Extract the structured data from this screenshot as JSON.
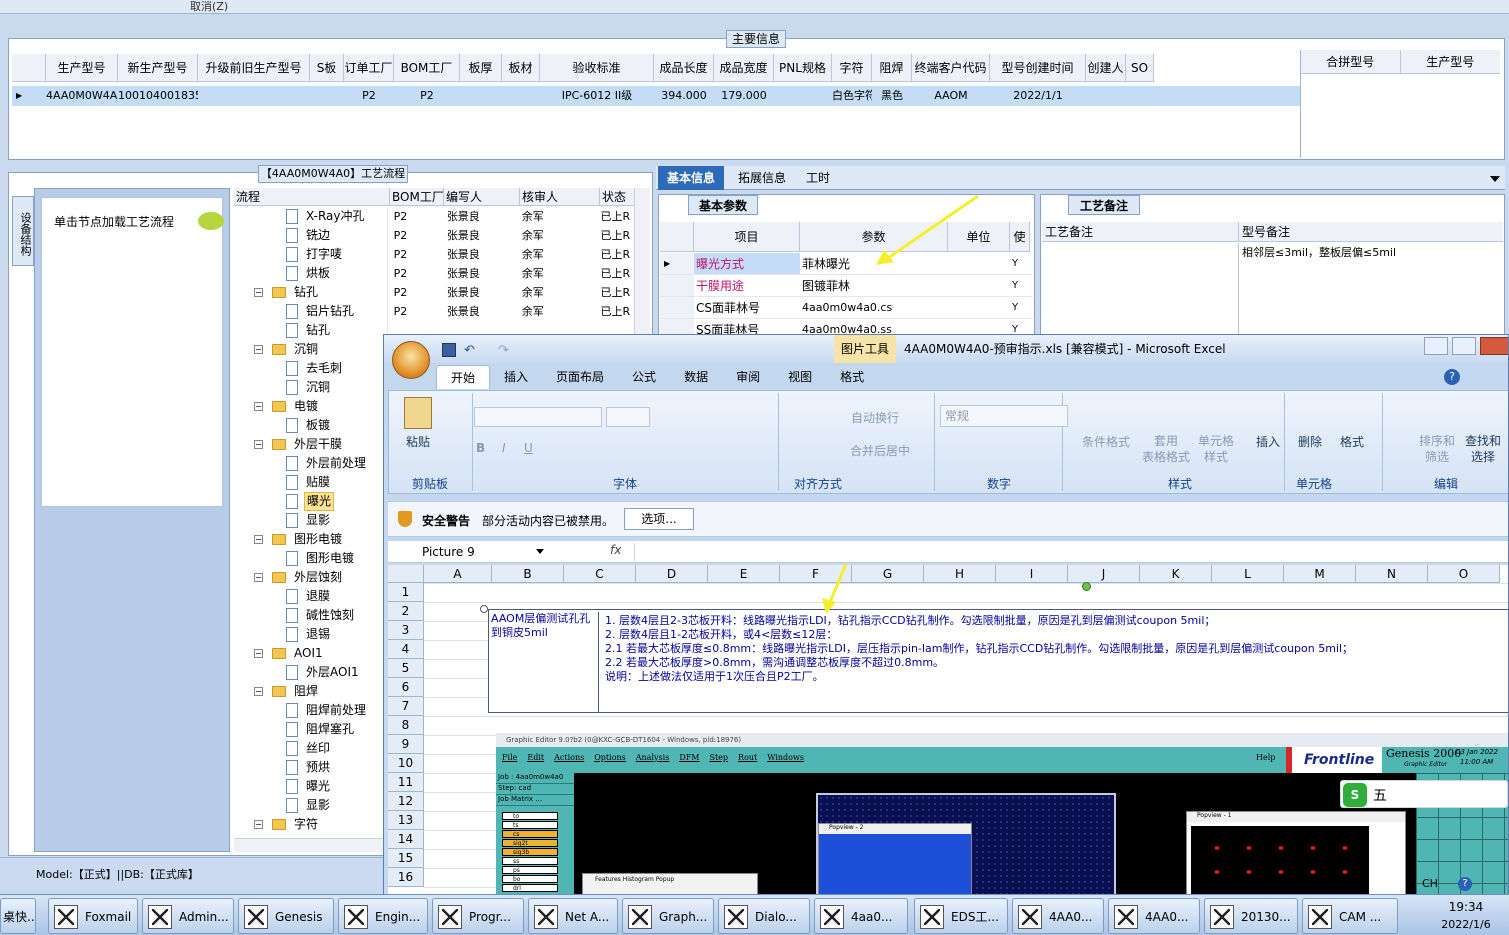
{
  "top_toolbar": {
    "cancel": "取消(Z)"
  },
  "main_info": {
    "title": "主要信息",
    "headers": [
      "生产型号",
      "新生产型号",
      "升级前旧生产型号",
      "S板",
      "订单工厂",
      "BOM工厂",
      "板厚",
      "板材",
      "验收标准",
      "成品长度",
      "成品宽度",
      "PNL规格",
      "字符",
      "阻焊",
      "终端客户代码",
      "型号创建时间",
      "创建人",
      "SO"
    ],
    "row": [
      "4AA0M0W4A0",
      "10010400183527",
      "",
      "",
      "P2",
      "P2",
      "",
      "",
      "IPC-6012 II级",
      "394.000",
      "179.000",
      "",
      "白色字符",
      "黑色",
      "AAOM",
      "2022/1/1",
      "",
      ""
    ],
    "right_headers": [
      "合拼型号",
      "生产型号"
    ]
  },
  "flow": {
    "title": "【4AA0M0W4A0】工艺流程",
    "side_tab": "设备结构",
    "node_hint": "单击节点加载工艺流程",
    "headers": [
      "流程",
      "BOM工厂",
      "编写人",
      "核审人",
      "状态"
    ],
    "rows": [
      {
        "level": 2,
        "type": "doc",
        "name": "X-Ray冲孔",
        "bom": "P2",
        "writer": "张景良",
        "reviewer": "余军",
        "status": "已上R"
      },
      {
        "level": 2,
        "type": "doc",
        "name": "铣边",
        "bom": "P2",
        "writer": "张景良",
        "reviewer": "余军",
        "status": "已上R"
      },
      {
        "level": 2,
        "type": "doc",
        "name": "打字唛",
        "bom": "P2",
        "writer": "张景良",
        "reviewer": "余军",
        "status": "已上R"
      },
      {
        "level": 2,
        "type": "doc",
        "name": "烘板",
        "bom": "P2",
        "writer": "张景良",
        "reviewer": "余军",
        "status": "已上R"
      },
      {
        "level": 1,
        "type": "folder",
        "name": "钻孔",
        "bom": "P2",
        "writer": "张景良",
        "reviewer": "余军",
        "status": "已上R"
      },
      {
        "level": 2,
        "type": "doc",
        "name": "铝片钻孔",
        "bom": "P2",
        "writer": "张景良",
        "reviewer": "余军",
        "status": "已上R"
      },
      {
        "level": 2,
        "type": "doc",
        "name": "钻孔",
        "bom": "",
        "writer": "",
        "reviewer": "",
        "status": ""
      },
      {
        "level": 1,
        "type": "folder",
        "name": "沉铜",
        "bom": "",
        "writer": "",
        "reviewer": "",
        "status": ""
      },
      {
        "level": 2,
        "type": "doc",
        "name": "去毛刺",
        "bom": "",
        "writer": "",
        "reviewer": "",
        "status": ""
      },
      {
        "level": 2,
        "type": "doc",
        "name": "沉铜",
        "bom": "",
        "writer": "",
        "reviewer": "",
        "status": ""
      },
      {
        "level": 1,
        "type": "folder",
        "name": "电镀",
        "bom": "",
        "writer": "",
        "reviewer": "",
        "status": ""
      },
      {
        "level": 2,
        "type": "doc",
        "name": "板镀",
        "bom": "",
        "writer": "",
        "reviewer": "",
        "status": ""
      },
      {
        "level": 1,
        "type": "folder",
        "name": "外层干膜",
        "bom": "",
        "writer": "",
        "reviewer": "",
        "status": ""
      },
      {
        "level": 2,
        "type": "doc",
        "name": "外层前处理",
        "bom": "",
        "writer": "",
        "reviewer": "",
        "status": ""
      },
      {
        "level": 2,
        "type": "doc",
        "name": "贴膜",
        "bom": "",
        "writer": "",
        "reviewer": "",
        "status": ""
      },
      {
        "level": 2,
        "type": "doc",
        "name": "曝光",
        "bom": "",
        "writer": "",
        "reviewer": "",
        "status": "",
        "selected": true
      },
      {
        "level": 2,
        "type": "doc",
        "name": "显影",
        "bom": "",
        "writer": "",
        "reviewer": "",
        "status": ""
      },
      {
        "level": 1,
        "type": "folder",
        "name": "图形电镀",
        "bom": "",
        "writer": "",
        "reviewer": "",
        "status": ""
      },
      {
        "level": 2,
        "type": "doc",
        "name": "图形电镀",
        "bom": "",
        "writer": "",
        "reviewer": "",
        "status": ""
      },
      {
        "level": 1,
        "type": "folder",
        "name": "外层蚀刻",
        "bom": "",
        "writer": "",
        "reviewer": "",
        "status": ""
      },
      {
        "level": 2,
        "type": "doc",
        "name": "退膜",
        "bom": "",
        "writer": "",
        "reviewer": "",
        "status": ""
      },
      {
        "level": 2,
        "type": "doc",
        "name": "碱性蚀刻",
        "bom": "",
        "writer": "",
        "reviewer": "",
        "status": ""
      },
      {
        "level": 2,
        "type": "doc",
        "name": "退锡",
        "bom": "",
        "writer": "",
        "reviewer": "",
        "status": ""
      },
      {
        "level": 1,
        "type": "folder",
        "name": "AOI1",
        "bom": "",
        "writer": "",
        "reviewer": "",
        "status": ""
      },
      {
        "level": 2,
        "type": "doc",
        "name": "外层AOI1",
        "bom": "",
        "writer": "",
        "reviewer": "",
        "status": ""
      },
      {
        "level": 1,
        "type": "folder",
        "name": "阻焊",
        "bom": "",
        "writer": "",
        "reviewer": "",
        "status": ""
      },
      {
        "level": 2,
        "type": "doc",
        "name": "阻焊前处理",
        "bom": "",
        "writer": "",
        "reviewer": "",
        "status": ""
      },
      {
        "level": 2,
        "type": "doc",
        "name": "阻焊塞孔",
        "bom": "",
        "writer": "",
        "reviewer": "",
        "status": ""
      },
      {
        "level": 2,
        "type": "doc",
        "name": "丝印",
        "bom": "",
        "writer": "",
        "reviewer": "",
        "status": ""
      },
      {
        "level": 2,
        "type": "doc",
        "name": "预烘",
        "bom": "",
        "writer": "",
        "reviewer": "",
        "status": ""
      },
      {
        "level": 2,
        "type": "doc",
        "name": "曝光",
        "bom": "",
        "writer": "",
        "reviewer": "",
        "status": ""
      },
      {
        "level": 2,
        "type": "doc",
        "name": "显影",
        "bom": "",
        "writer": "",
        "reviewer": "",
        "status": ""
      },
      {
        "level": 1,
        "type": "folder",
        "name": "字符",
        "bom": "",
        "writer": "",
        "reviewer": "",
        "status": ""
      }
    ]
  },
  "tabs": [
    "基本信息",
    "拓展信息",
    "工时"
  ],
  "basic_params": {
    "title": "基本参数",
    "headers": [
      "项目",
      "参数",
      "单位",
      "使"
    ],
    "rows": [
      {
        "item": "曝光方式",
        "param": "菲林曝光",
        "unit": "",
        "use": "Y",
        "pink": true
      },
      {
        "item": "干膜用途",
        "param": "图镀菲林",
        "unit": "",
        "use": "Y",
        "pink": true
      },
      {
        "item": "CS面菲林号",
        "param": "4aa0m0w4a0.cs",
        "unit": "",
        "use": "Y",
        "pink": false
      },
      {
        "item": "SS面菲林号",
        "param": "4aa0m0w4a0.ss",
        "unit": "",
        "use": "Y",
        "pink": false
      }
    ]
  },
  "process_note": {
    "title": "工艺备注",
    "col1": "工艺备注",
    "col2": "型号备注",
    "model_note": "相邻层≤3mil，整板层偏≤5mil"
  },
  "status_bar": "Model:【正式】||DB:【正式库】",
  "excel": {
    "title": "4AA0M0W4A0-预审指示.xls  [兼容模式] - Microsoft Excel",
    "context_tab": "图片工具",
    "ribbon_tabs": [
      "开始",
      "插入",
      "页面布局",
      "公式",
      "数据",
      "审阅",
      "视图",
      "格式"
    ],
    "groups": [
      "剪贴板",
      "字体",
      "对齐方式",
      "数字",
      "样式",
      "单元格",
      "编辑"
    ],
    "buttons": {
      "paste": "粘贴",
      "wrap": "自动换行",
      "merge": "合并后居中",
      "number_format": "常规",
      "cond_format": "条件格式",
      "table_format": "套用\n表格格式",
      "cell_style": "单元格\n样式",
      "insert": "插入",
      "delete": "删除",
      "format": "格式",
      "sort": "排序和\n筛选",
      "find": "查找和\n选择"
    },
    "security_title": "安全警告",
    "security_msg": "部分活动内容已被禁用。",
    "options": "选项...",
    "name_box": "Picture 9",
    "fx": "fx",
    "columns": [
      "A",
      "B",
      "C",
      "D",
      "E",
      "F",
      "G",
      "H",
      "I",
      "J",
      "K",
      "L",
      "M",
      "N",
      "O"
    ],
    "rows": [
      "1",
      "2",
      "3",
      "4",
      "5",
      "6",
      "7",
      "8",
      "9",
      "10",
      "11",
      "12",
      "13",
      "14",
      "15",
      "16"
    ],
    "b_text": "AAOM层偏测试孔孔到铜皮5mil",
    "lines": [
      "1. 层数4层且2-3芯板开料：线路曝光指示LDI，钻孔指示CCD钻孔制作。勾选限制批量，原因是孔到层偏测试coupon  5mil；",
      "2. 层数4层且1-2芯板开料，或4<层数≤12层：",
      "2.1 若最大芯板厚度≤0.8mm：线路曝光指示LDI，层压指示pin-lam制作，钻孔指示CCD钻孔制作。勾选限制批量，原因是孔到层偏测试coupon  5mil；",
      "2.2 若最大芯板厚度>0.8mm，需沟通调整芯板厚度不超过0.8mm。",
      "说明：上述做法仅适用于1次压合且P2工厂。"
    ]
  },
  "genesis": {
    "title": "Graphic Editor 9.0?b2 (0@KXC-GCB-DT1604 - Windows, pid:18976)",
    "menus": [
      "File",
      "Edit",
      "Actions",
      "Options",
      "Analysis",
      "DFM",
      "Step",
      "Rout",
      "Windows"
    ],
    "help": "Help",
    "brand": "Frontline",
    "product": "Genesis 2000",
    "sub": "Graphic Editor",
    "date": "03 Jan 2022",
    "time": "11:00 AM",
    "job": "Job : 4aa0m0w4a0",
    "step": "Step: cad",
    "matrix": "Job Matrix ...",
    "layers": [
      "to",
      "ts",
      "cs",
      "sig2t",
      "sig3b",
      "ss",
      "ps",
      "bo",
      "drl"
    ],
    "popview2": "Popview - 2",
    "popview1": "Popview - 1",
    "histogram": "Features Histogram Popup"
  },
  "taskbar": {
    "items": [
      "桌快...",
      "Foxmail",
      "Admin...",
      "Genesis",
      "Engin...",
      "Progr...",
      "Net A...",
      "Graph...",
      "Dialo...",
      "4aa0...",
      "EDS工...",
      "4AA0...",
      "4AA0...",
      "20130...",
      "CAM ..."
    ],
    "time": "19:34",
    "date": "2022/1/6",
    "ime": "CH"
  },
  "ime_bar": "五",
  "colors": {
    "selection": "#c4dcf5",
    "title_blue": "#dde9f7",
    "pink": "#c0126a",
    "genesis_bg": "#4fb6b4",
    "folder": "#f3c552"
  }
}
